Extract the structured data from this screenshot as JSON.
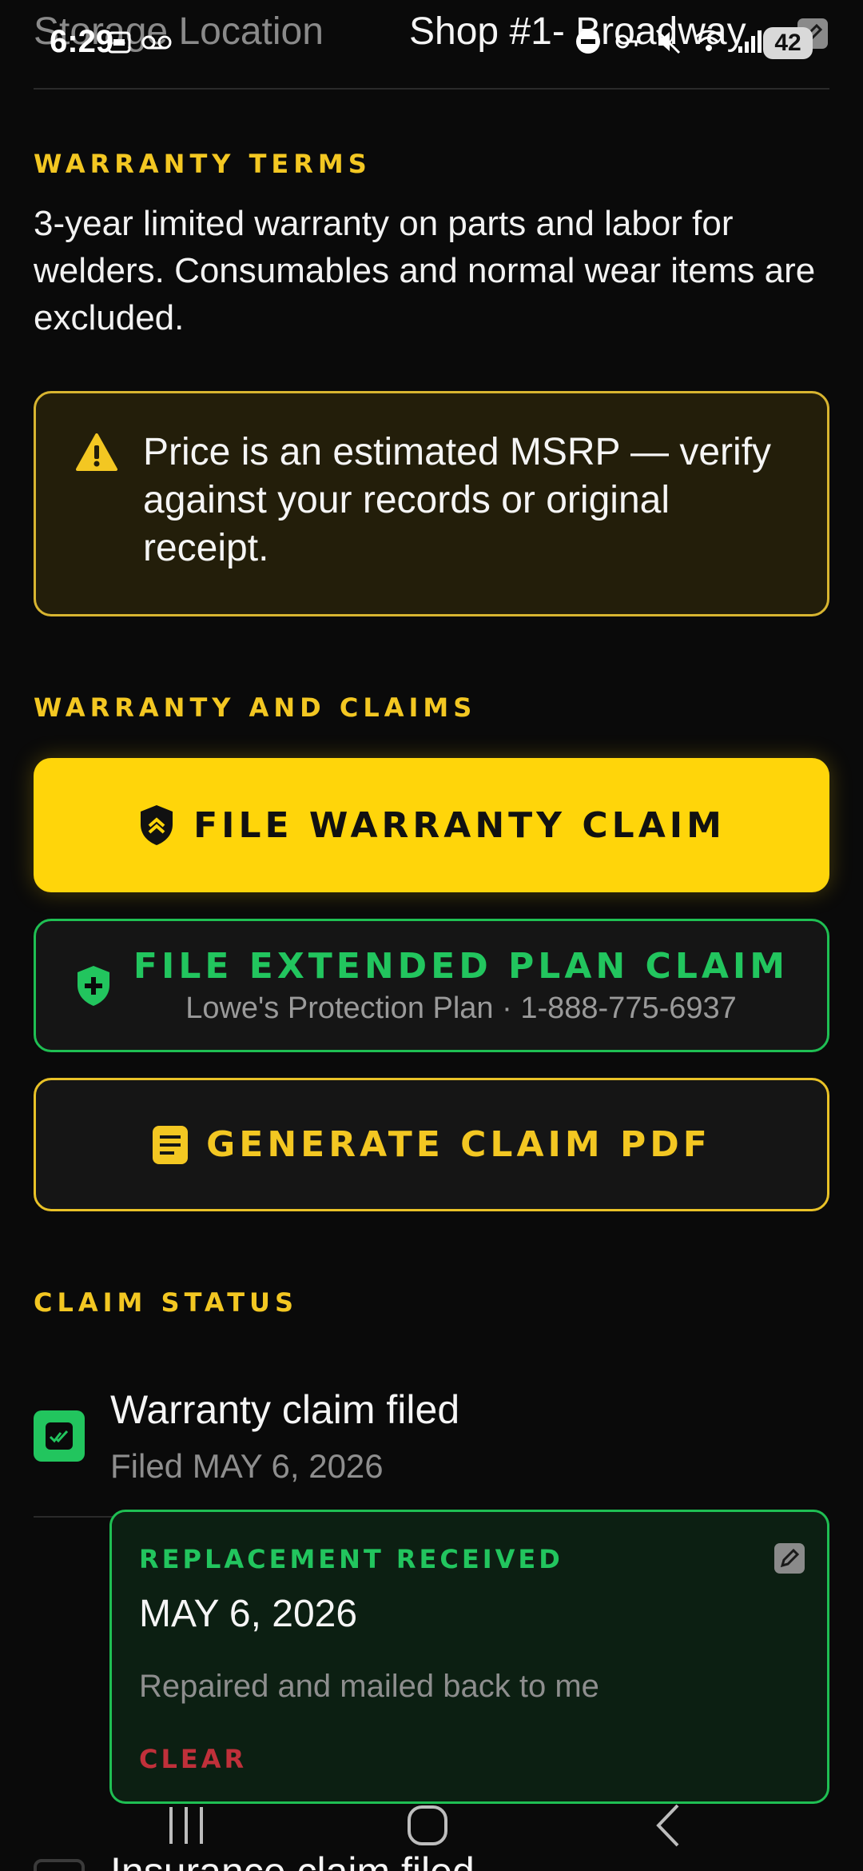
{
  "header": {
    "label": "Storage Location",
    "value": "Shop #1- Broadway"
  },
  "status_bar": {
    "time": "6:29",
    "battery": "42"
  },
  "warranty_terms": {
    "title": "WARRANTY TERMS",
    "text": "3-year limited warranty on parts and labor for welders. Consumables and normal wear items are excluded."
  },
  "notice": {
    "icon": "warning-icon",
    "text": "Price is an estimated MSRP — verify against your records or original receipt."
  },
  "warranty_claims": {
    "title": "WARRANTY AND CLAIMS",
    "file_warranty": "FILE WARRANTY CLAIM",
    "file_extended": "FILE EXTENDED PLAN CLAIM",
    "extended_sub": "Lowe's Protection Plan · 1-888-775-6937",
    "generate_pdf": "GENERATE CLAIM PDF"
  },
  "claim_status": {
    "title": "CLAIM STATUS",
    "filed": {
      "label": "Warranty claim filed",
      "sub": "Filed MAY 6, 2026",
      "checked": true
    },
    "replacement": {
      "heading": "REPLACEMENT RECEIVED",
      "date": "MAY 6, 2026",
      "note": "Repaired and mailed back to me",
      "clear": "CLEAR"
    },
    "next_item": "Insurance claim filed"
  },
  "colors": {
    "accent_yellow": "#ffd50a",
    "accent_green": "#22c55e",
    "danger": "#c0303a",
    "background": "#0a0a0a"
  }
}
